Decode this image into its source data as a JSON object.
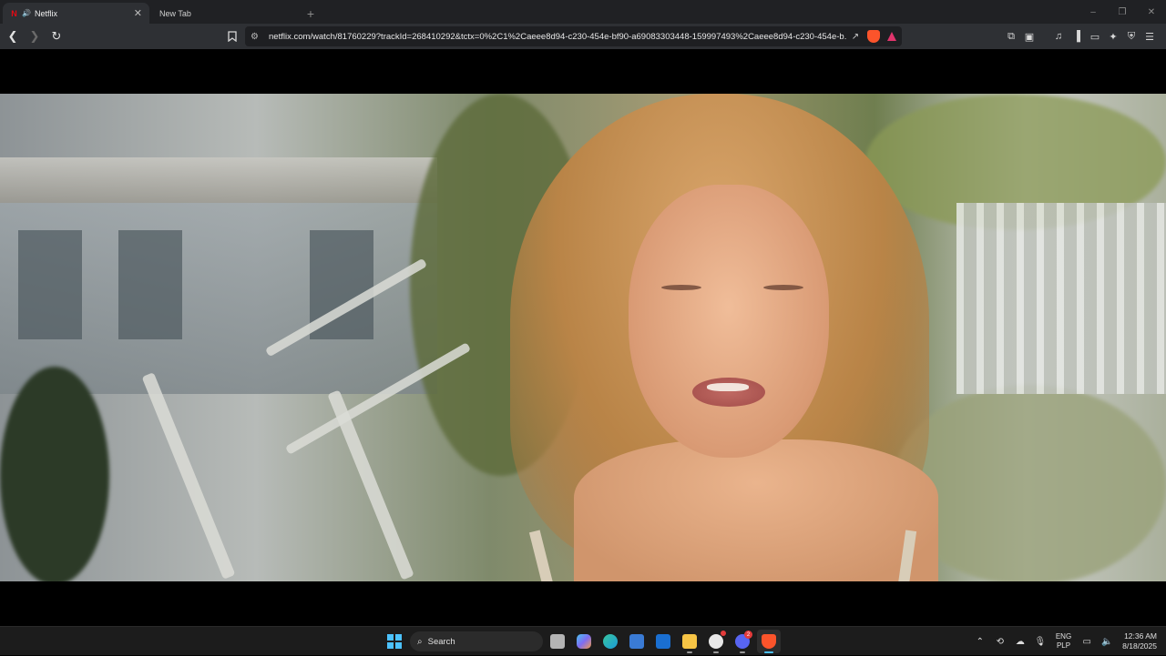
{
  "browser": {
    "tabs": [
      {
        "title": "Netflix",
        "active": true
      },
      {
        "title": "New Tab",
        "active": false
      }
    ],
    "new_tab_symbol": "+",
    "window_controls": [
      "–",
      "❐",
      "✕"
    ],
    "url": "netflix.com/watch/81760229?trackId=268410292&tctx=0%2C1%2Caeee8d94-c230-454e-bf90-a69083303448-159997493%2Caeee8d94-c230-454e-b...",
    "icons": {
      "back": "back-arrow-icon",
      "forward": "forward-arrow-icon",
      "reload": "reload-icon",
      "bookmark": "bookmark-icon",
      "site_settings": "tune-icon",
      "share": "share-icon",
      "brave_shield": "brave-shield-icon",
      "brave_rewards": "brave-rewards-icon"
    },
    "accent_colors": {
      "netflix": "#e50914",
      "brave": "#fb542b"
    }
  },
  "video": {
    "description_icon": "video-frame"
  },
  "taskbar": {
    "search_placeholder": "Search",
    "apps": [
      {
        "name": "task-view",
        "color": "#cfcfcf"
      },
      {
        "name": "copilot",
        "color": "#7e6cf2"
      },
      {
        "name": "edge",
        "color": "#1c9bd8"
      },
      {
        "name": "store",
        "color": "#3a7bd5"
      },
      {
        "name": "outlook",
        "color": "#1a6fd1"
      },
      {
        "name": "file-explorer",
        "color": "#f6c445"
      },
      {
        "name": "github",
        "color": "#e8e8e8",
        "badge": ""
      },
      {
        "name": "discord",
        "color": "#5865f2",
        "badge": "2"
      },
      {
        "name": "brave",
        "color": "#fb542b"
      }
    ],
    "tray": {
      "lang_top": "ENG",
      "lang_bottom": "PLP",
      "time": "12:36 AM",
      "date": "8/18/2025"
    }
  }
}
